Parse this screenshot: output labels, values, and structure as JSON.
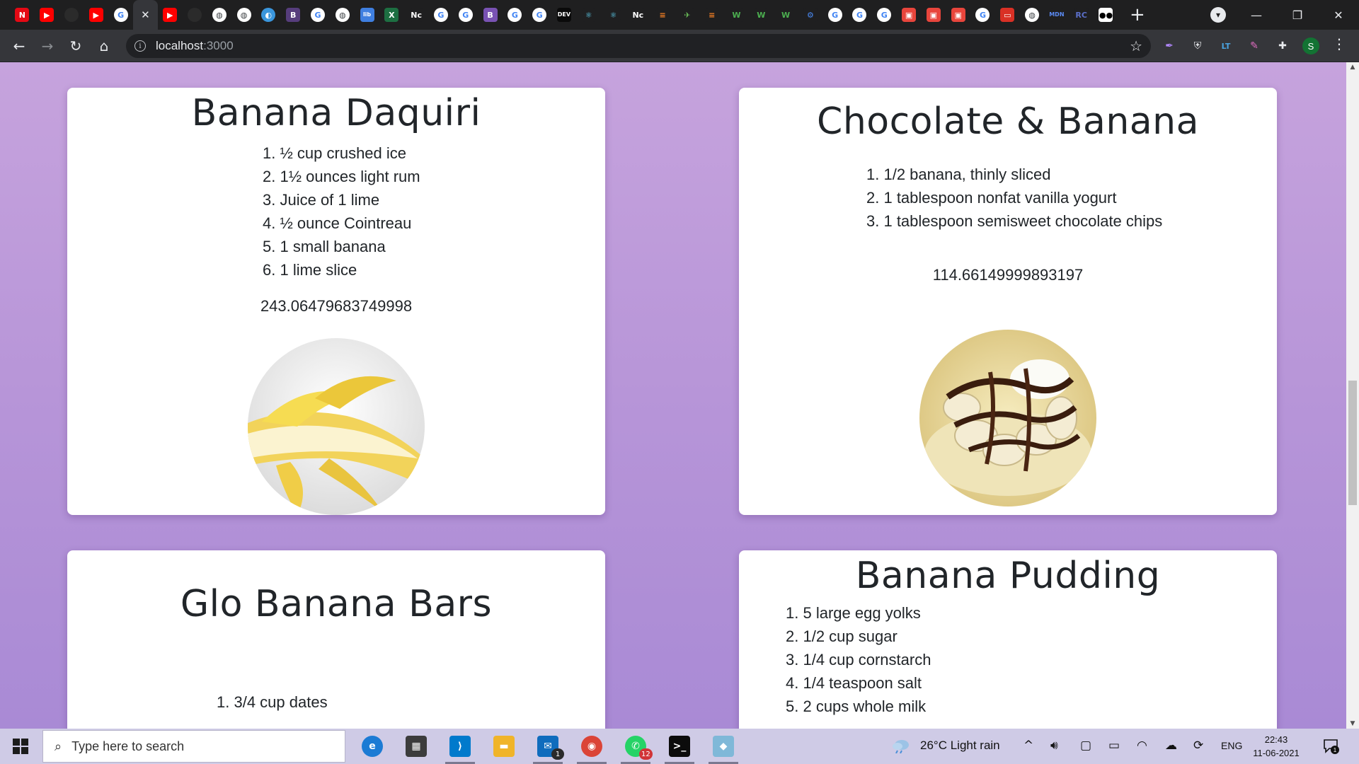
{
  "browser": {
    "tabs": [
      {
        "icon": "netflix-icon",
        "glyph": "N",
        "bg": "#e50914",
        "fg": "#ffffff"
      },
      {
        "icon": "youtube-icon",
        "glyph": "▶",
        "bg": "#ff0000",
        "fg": "#ffffff"
      },
      {
        "icon": "github-icon",
        "glyph": "",
        "bg": "#2b2b2b",
        "fg": "#ffffff",
        "round": true
      },
      {
        "icon": "youtube-icon",
        "glyph": "▶",
        "bg": "#ff0000",
        "fg": "#ffffff"
      },
      {
        "icon": "google-icon",
        "glyph": "G",
        "bg": "#ffffff",
        "fg": "#4285f4",
        "round": true
      },
      {
        "icon": "close-icon",
        "glyph": "✕",
        "active": true
      },
      {
        "icon": "youtube-icon",
        "glyph": "▶",
        "bg": "#ff0000",
        "fg": "#ffffff"
      },
      {
        "icon": "github-icon",
        "glyph": "",
        "bg": "#2b2b2b",
        "fg": "#ffffff",
        "round": true
      },
      {
        "icon": "globe-icon",
        "glyph": "◍",
        "bg": "#ffffff",
        "fg": "#3c4043",
        "round": true
      },
      {
        "icon": "globe-icon",
        "glyph": "◍",
        "bg": "#ffffff",
        "fg": "#3c4043",
        "round": true
      },
      {
        "icon": "edge-icon",
        "glyph": "◐",
        "bg": "#3a96dd",
        "fg": "#ffffff",
        "round": true
      },
      {
        "icon": "bootstrap-icon",
        "glyph": "B",
        "bg": "#563d7c",
        "fg": "#ffffff"
      },
      {
        "icon": "google-icon",
        "glyph": "G",
        "bg": "#ffffff",
        "fg": "#4285f4",
        "round": true
      },
      {
        "icon": "globe-icon",
        "glyph": "◍",
        "bg": "#ffffff",
        "fg": "#3c4043",
        "round": true
      },
      {
        "icon": "libre-icon",
        "glyph": "lib",
        "bg": "#3f7fe0",
        "fg": "#ffffff"
      },
      {
        "icon": "excel-icon",
        "glyph": "X",
        "bg": "#1d6f42",
        "fg": "#ffffff"
      },
      {
        "icon": "notion-icon",
        "glyph": "Nc",
        "bg": "#1f1f20",
        "fg": "#ffffff"
      },
      {
        "icon": "google-icon",
        "glyph": "G",
        "bg": "#ffffff",
        "fg": "#4285f4",
        "round": true
      },
      {
        "icon": "google-icon",
        "glyph": "G",
        "bg": "#ffffff",
        "fg": "#4285f4",
        "round": true
      },
      {
        "icon": "bootstrap-icon",
        "glyph": "B",
        "bg": "#7952b3",
        "fg": "#ffffff"
      },
      {
        "icon": "google-icon",
        "glyph": "G",
        "bg": "#ffffff",
        "fg": "#4285f4",
        "round": true
      },
      {
        "icon": "google-icon",
        "glyph": "G",
        "bg": "#ffffff",
        "fg": "#4285f4",
        "round": true
      },
      {
        "icon": "dev-icon",
        "glyph": "DEV",
        "bg": "#0a0a0a",
        "fg": "#ffffff"
      },
      {
        "icon": "react-icon",
        "glyph": "⚛",
        "bg": "#1f1f20",
        "fg": "#61dafb"
      },
      {
        "icon": "react-icon",
        "glyph": "⚛",
        "bg": "#1f1f20",
        "fg": "#61dafb"
      },
      {
        "icon": "notion-icon",
        "glyph": "Nc",
        "bg": "#1f1f20",
        "fg": "#ffffff"
      },
      {
        "icon": "stackoverflow-icon",
        "glyph": "≡",
        "bg": "#1f1f20",
        "fg": "#f48024"
      },
      {
        "icon": "hummingbird-icon",
        "glyph": "✈",
        "bg": "#1f1f20",
        "fg": "#6bbf59"
      },
      {
        "icon": "stackoverflow-icon",
        "glyph": "≡",
        "bg": "#1f1f20",
        "fg": "#f48024"
      },
      {
        "icon": "w3schools-icon",
        "glyph": "W",
        "bg": "#1f1f20",
        "fg": "#4caf50"
      },
      {
        "icon": "w3schools-icon",
        "glyph": "W",
        "bg": "#1f1f20",
        "fg": "#4caf50"
      },
      {
        "icon": "w3schools-icon",
        "glyph": "W",
        "bg": "#1f1f20",
        "fg": "#4caf50"
      },
      {
        "icon": "gear-icon",
        "glyph": "⚙",
        "bg": "#1f1f20",
        "fg": "#4a8af4"
      },
      {
        "icon": "google-icon",
        "glyph": "G",
        "bg": "#ffffff",
        "fg": "#4285f4",
        "round": true
      },
      {
        "icon": "google-icon",
        "glyph": "G",
        "bg": "#ffffff",
        "fg": "#4285f4",
        "round": true
      },
      {
        "icon": "google-icon",
        "glyph": "G",
        "bg": "#ffffff",
        "fg": "#4285f4",
        "round": true
      },
      {
        "icon": "slides-icon",
        "glyph": "▣",
        "bg": "#e8453c",
        "fg": "#ffffff"
      },
      {
        "icon": "slides-icon",
        "glyph": "▣",
        "bg": "#e8453c",
        "fg": "#ffffff"
      },
      {
        "icon": "slides-icon",
        "glyph": "▣",
        "bg": "#e8453c",
        "fg": "#ffffff"
      },
      {
        "icon": "google-icon",
        "glyph": "G",
        "bg": "#ffffff",
        "fg": "#4285f4",
        "round": true
      },
      {
        "icon": "laptop-icon",
        "glyph": "▭",
        "bg": "#d93025",
        "fg": "#ffffff"
      },
      {
        "icon": "globe-icon",
        "glyph": "◍",
        "bg": "#ffffff",
        "fg": "#3c4043",
        "round": true
      },
      {
        "icon": "mdn-icon",
        "glyph": "MDN",
        "bg": "#1f1f20",
        "fg": "#5b8bf5"
      },
      {
        "icon": "react-icon",
        "glyph": "RC",
        "bg": "#1f1f20",
        "fg": "#5b6fc9"
      },
      {
        "icon": "medium-icon",
        "glyph": "●●",
        "bg": "#ffffff",
        "fg": "#000000"
      }
    ],
    "url_host": "localhost",
    "url_port": ":3000"
  },
  "recipes": [
    {
      "title": "Banana Daquiri",
      "ingredients": [
        "½ cup crushed ice",
        "1½ ounces light rum",
        "Juice of 1 lime",
        "½ ounce Cointreau",
        "1 small banana",
        "1 lime slice"
      ],
      "number": "243.06479683749998",
      "image": "peeled-banana-photo"
    },
    {
      "title": "Chocolate & Banana",
      "ingredients": [
        "1/2 banana, thinly sliced",
        "1 tablespoon nonfat vanilla yogurt",
        "1 tablespoon semisweet chocolate chips"
      ],
      "number": "114.66149999893197",
      "image": "chocolate-banana-photo"
    },
    {
      "title": "Glo Banana Bars",
      "ingredients": [
        "3/4 cup dates"
      ]
    },
    {
      "title": "Banana Pudding",
      "ingredients": [
        "5 large egg yolks",
        "1/2 cup sugar",
        "1/4 cup cornstarch",
        "1/4 teaspoon salt",
        "2 cups whole milk"
      ]
    }
  ],
  "taskbar": {
    "search_placeholder": "Type here to search",
    "apps": [
      {
        "icon": "edge-icon",
        "glyph": "e",
        "bg": "#1c7bd4",
        "round": true
      },
      {
        "icon": "store-icon",
        "glyph": "▦",
        "bg": "#3c3c3c"
      },
      {
        "icon": "vscode-icon",
        "glyph": "⟩",
        "bg": "#007acc",
        "running": true
      },
      {
        "icon": "file-explorer-icon",
        "glyph": "▬",
        "bg": "#f0b429"
      },
      {
        "icon": "mail-icon",
        "glyph": "✉",
        "bg": "#0f6cbd",
        "badge": "1",
        "badge_bg": "#2b2b2b",
        "running": true
      },
      {
        "icon": "chrome-icon",
        "glyph": "◉",
        "bg": "#db4437",
        "round": true,
        "running": true
      },
      {
        "icon": "whatsapp-icon",
        "glyph": "✆",
        "bg": "#25d366",
        "round": true,
        "badge": "12",
        "badge_bg": "#d13438",
        "running": true
      },
      {
        "icon": "terminal-icon",
        "glyph": ">_",
        "bg": "#0c0c0c",
        "running": true
      },
      {
        "icon": "notes-icon",
        "glyph": "◆",
        "bg": "#7fb8d8",
        "running": true
      }
    ],
    "weather": "26°C  Light rain",
    "language": "ENG",
    "time": "22:43",
    "date": "11-06-2021",
    "notification_count": "1"
  }
}
